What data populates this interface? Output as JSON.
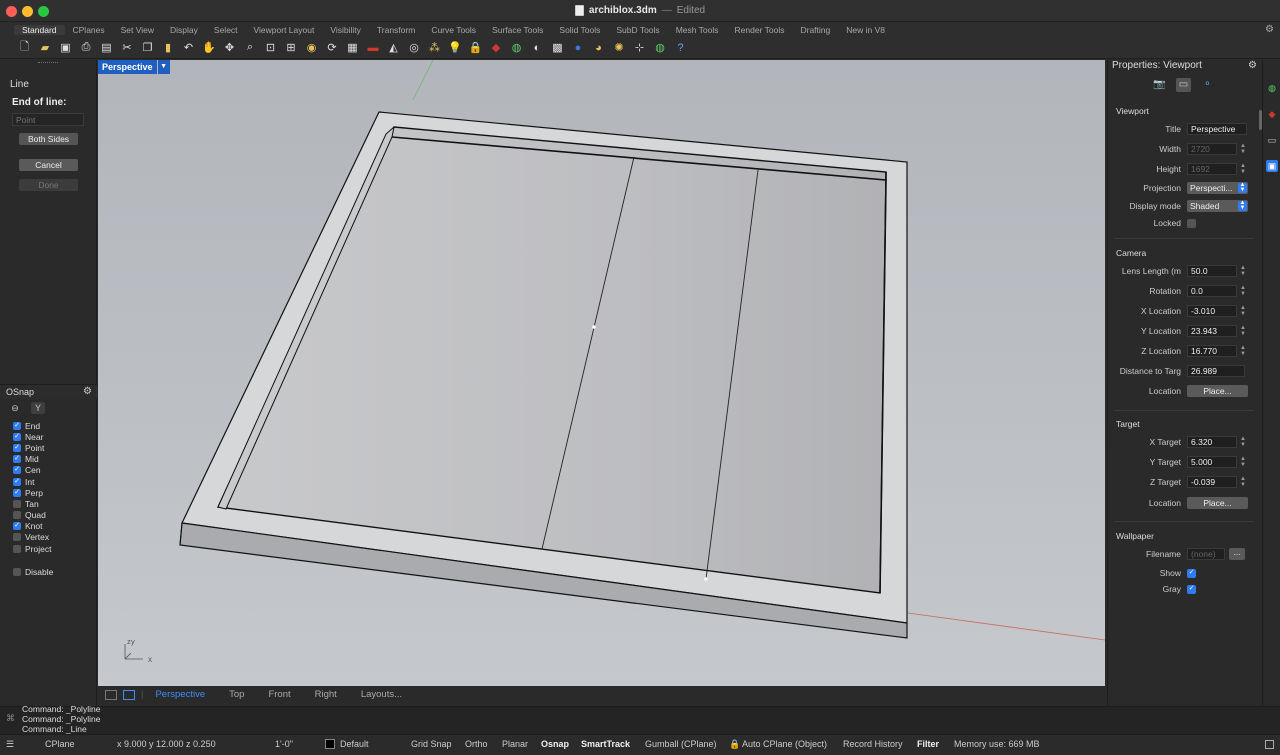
{
  "window": {
    "title": "archiblox.3dm",
    "separator": "—",
    "state": "Edited",
    "traffic_lights": {
      "close": "#ff5f57",
      "minimize": "#febc2e",
      "zoom": "#28c840"
    }
  },
  "tabs": [
    "Standard",
    "CPlanes",
    "Set View",
    "Display",
    "Select",
    "Viewport Layout",
    "Visibility",
    "Transform",
    "Curve Tools",
    "Surface Tools",
    "Solid Tools",
    "SubD Tools",
    "Mesh Tools",
    "Render Tools",
    "Drafting",
    "New in V8"
  ],
  "active_tab": "Standard",
  "toolbar_icons": [
    "new-file-icon",
    "open-file-icon",
    "save-icon",
    "print-icon",
    "paste-special-icon",
    "cut-icon",
    "copy-icon",
    "paste-icon",
    "undo-icon",
    "pan-hand-icon",
    "rotate-view-icon",
    "zoom-icon",
    "zoom-window-icon",
    "zoom-extents-icon",
    "zoom-selected-icon",
    "rotate-icon",
    "four-viewports-icon",
    "car-render-icon",
    "properties-icon",
    "circle-icon",
    "points-icon",
    "light-icon",
    "lock-icon",
    "layer-icon",
    "color-wheel-icon",
    "sphere-icon",
    "display-mode-icon",
    "material-sphere-icon",
    "render-teapot-icon",
    "sun-icon",
    "grid-icon",
    "globe-icon",
    "help-icon"
  ],
  "left_panel": {
    "command": "Line",
    "prompt": "End of line:",
    "point_placeholder": "Point",
    "buttons": {
      "both_sides": "Both Sides",
      "cancel": "Cancel",
      "done": "Done"
    },
    "osnap": {
      "title": "OSnap",
      "items": [
        {
          "label": "End",
          "checked": true
        },
        {
          "label": "Near",
          "checked": true
        },
        {
          "label": "Point",
          "checked": true
        },
        {
          "label": "Mid",
          "checked": true
        },
        {
          "label": "Cen",
          "checked": true
        },
        {
          "label": "Int",
          "checked": true
        },
        {
          "label": "Perp",
          "checked": true
        },
        {
          "label": "Tan",
          "checked": false
        },
        {
          "label": "Quad",
          "checked": false
        },
        {
          "label": "Knot",
          "checked": true
        },
        {
          "label": "Vertex",
          "checked": false
        },
        {
          "label": "Project",
          "checked": false
        }
      ],
      "disable_label": "Disable"
    }
  },
  "viewport": {
    "title": "Perspective",
    "axis_labels": {
      "z": "z",
      "y": "y",
      "x": "x"
    },
    "tabs": [
      "Perspective",
      "Top",
      "Front",
      "Right",
      "Layouts..."
    ],
    "active_tab": "Perspective"
  },
  "properties": {
    "title": "Properties: Viewport",
    "viewport_section": "Viewport",
    "title_label": "Title",
    "title_value": "Perspective",
    "width_label": "Width",
    "width_value": "2720",
    "height_label": "Height",
    "height_value": "1692",
    "projection_label": "Projection",
    "projection_value": "Perspecti...",
    "display_mode_label": "Display mode",
    "display_mode_value": "Shaded",
    "locked_label": "Locked",
    "camera_section": "Camera",
    "lens_label": "Lens Length (m",
    "lens_value": "50.0",
    "rotation_label": "Rotation",
    "rotation_value": "0.0",
    "xloc_label": "X Location",
    "xloc_value": "-3.010",
    "yloc_label": "Y Location",
    "yloc_value": "23.943",
    "zloc_label": "Z Location",
    "zloc_value": "16.770",
    "dist_label": "Distance to Targ",
    "dist_value": "26.989",
    "location_label": "Location",
    "place_button": "Place...",
    "target_section": "Target",
    "xtarget_label": "X Target",
    "xtarget_value": "6.320",
    "ytarget_label": "Y Target",
    "ytarget_value": "5.000",
    "ztarget_label": "Z Target",
    "ztarget_value": "-0.039",
    "target_location_label": "Location",
    "target_place_button": "Place...",
    "wallpaper_section": "Wallpaper",
    "filename_label": "Filename",
    "filename_value": "(none)",
    "browse_button": "...",
    "show_label": "Show",
    "show_checked": true,
    "gray_label": "Gray",
    "gray_checked": true
  },
  "command_history": [
    "Command: _Polyline",
    "Command: _Polyline",
    "Command: _Line"
  ],
  "status": {
    "cplane": "CPlane",
    "coords": "x 9.000  y 12.000  z 0.250",
    "units": "1'-0\"",
    "layer": "Default",
    "grid_snap": "Grid Snap",
    "ortho": "Ortho",
    "planar": "Planar",
    "osnap": "Osnap",
    "smarttrack": "SmartTrack",
    "gumball": "Gumball (CPlane)",
    "auto_cplane": "Auto CPlane (Object)",
    "record_history": "Record History",
    "filter": "Filter",
    "memory": "Memory use: 669 MB"
  },
  "colors": {
    "accent": "#2f7bf2",
    "viewport_title_bg": "#1f5fbf"
  }
}
